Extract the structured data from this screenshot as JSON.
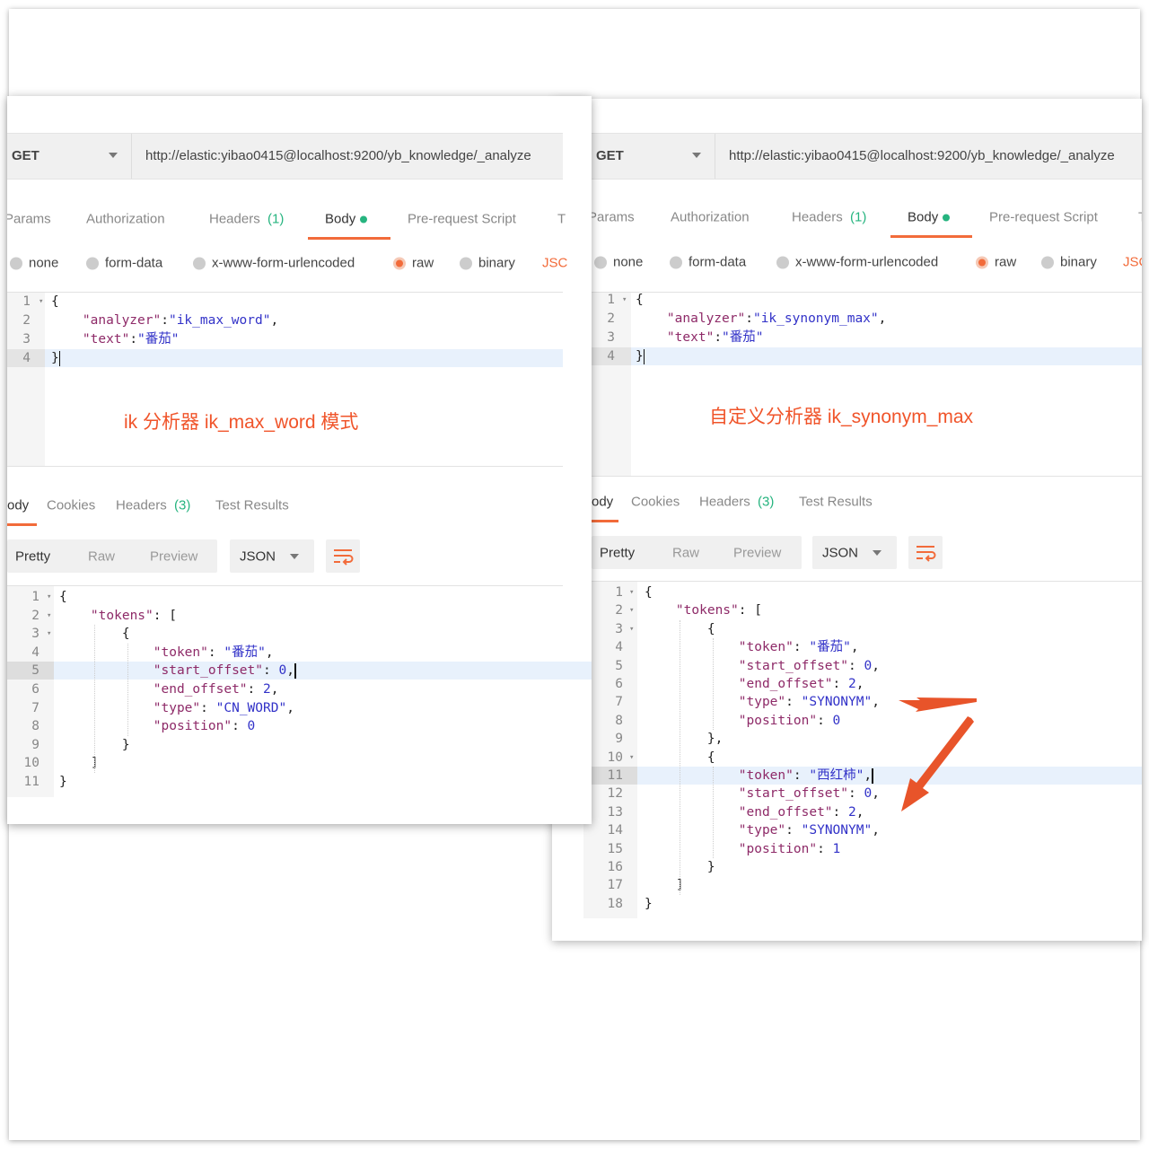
{
  "accent": "#f26b3a",
  "panels": [
    {
      "id": "left",
      "method": "GET",
      "url": "http://elastic:yibao0415@localhost:9200/yb_knowledge/_analyze",
      "tabs": [
        "Params",
        "Authorization",
        "Headers",
        "(1)",
        "Body",
        "Pre-request Script",
        "T"
      ],
      "body_types": [
        "none",
        "form-data",
        "x-www-form-urlencoded",
        "raw",
        "binary",
        "JSC"
      ],
      "annotation": "ik 分析器 ik_max_word 模式",
      "resp_tabs": [
        "ody",
        "Cookies",
        "Headers",
        "(3)",
        "Test Results"
      ],
      "formats": [
        "Pretty",
        "Raw",
        "Preview"
      ],
      "format_select": "JSON",
      "request_lines": [
        [
          [
            "p",
            "{"
          ]
        ],
        [
          [
            "p",
            "    "
          ],
          [
            "k",
            "\"analyzer\""
          ],
          [
            "p",
            ":"
          ],
          [
            "s",
            "\"ik_max_word\""
          ],
          [
            "p",
            ","
          ]
        ],
        [
          [
            "p",
            "    "
          ],
          [
            "k",
            "\"text\""
          ],
          [
            "p",
            ":"
          ],
          [
            "s",
            "\"番茄\""
          ]
        ],
        [
          [
            "p",
            "}"
          ]
        ]
      ],
      "response_lines": [
        [
          [
            "p",
            "{"
          ]
        ],
        [
          [
            "p",
            "    "
          ],
          [
            "k",
            "\"tokens\""
          ],
          [
            "p",
            ": ["
          ]
        ],
        [
          [
            "p",
            "        {"
          ]
        ],
        [
          [
            "p",
            "            "
          ],
          [
            "k",
            "\"token\""
          ],
          [
            "p",
            ": "
          ],
          [
            "s",
            "\"番茄\""
          ],
          [
            "p",
            ","
          ]
        ],
        [
          [
            "p",
            "            "
          ],
          [
            "k",
            "\"start_offset\""
          ],
          [
            "p",
            ": "
          ],
          [
            "n",
            "0"
          ],
          [
            "p",
            ","
          ]
        ],
        [
          [
            "p",
            "            "
          ],
          [
            "k",
            "\"end_offset\""
          ],
          [
            "p",
            ": "
          ],
          [
            "n",
            "2"
          ],
          [
            "p",
            ","
          ]
        ],
        [
          [
            "p",
            "            "
          ],
          [
            "k",
            "\"type\""
          ],
          [
            "p",
            ": "
          ],
          [
            "s",
            "\"CN_WORD\""
          ],
          [
            "p",
            ","
          ]
        ],
        [
          [
            "p",
            "            "
          ],
          [
            "k",
            "\"position\""
          ],
          [
            "p",
            ": "
          ],
          [
            "n",
            "0"
          ]
        ],
        [
          [
            "p",
            "        }"
          ]
        ],
        [
          [
            "p",
            "    ]"
          ]
        ],
        [
          [
            "p",
            "}"
          ]
        ]
      ],
      "response_folds": [
        1,
        2,
        3
      ],
      "response_highlight": 5
    },
    {
      "id": "right",
      "method": "GET",
      "url": "http://elastic:yibao0415@localhost:9200/yb_knowledge/_analyze",
      "tabs": [
        "Params",
        "Authorization",
        "Headers",
        "(1)",
        "Body",
        "Pre-request Script",
        "T"
      ],
      "body_types": [
        "none",
        "form-data",
        "x-www-form-urlencoded",
        "raw",
        "binary",
        "JSC"
      ],
      "annotation": "自定义分析器 ik_synonym_max",
      "resp_tabs": [
        "ody",
        "Cookies",
        "Headers",
        "(3)",
        "Test Results"
      ],
      "formats": [
        "Pretty",
        "Raw",
        "Preview"
      ],
      "format_select": "JSON",
      "request_lines": [
        [
          [
            "p",
            "{"
          ]
        ],
        [
          [
            "p",
            "    "
          ],
          [
            "k",
            "\"analyzer\""
          ],
          [
            "p",
            ":"
          ],
          [
            "s",
            "\"ik_synonym_max\""
          ],
          [
            "p",
            ","
          ]
        ],
        [
          [
            "p",
            "    "
          ],
          [
            "k",
            "\"text\""
          ],
          [
            "p",
            ":"
          ],
          [
            "s",
            "\"番茄\""
          ]
        ],
        [
          [
            "p",
            "}"
          ]
        ]
      ],
      "response_lines": [
        [
          [
            "p",
            "{"
          ]
        ],
        [
          [
            "p",
            "    "
          ],
          [
            "k",
            "\"tokens\""
          ],
          [
            "p",
            ": ["
          ]
        ],
        [
          [
            "p",
            "        {"
          ]
        ],
        [
          [
            "p",
            "            "
          ],
          [
            "k",
            "\"token\""
          ],
          [
            "p",
            ": "
          ],
          [
            "s",
            "\"番茄\""
          ],
          [
            "p",
            ","
          ]
        ],
        [
          [
            "p",
            "            "
          ],
          [
            "k",
            "\"start_offset\""
          ],
          [
            "p",
            ": "
          ],
          [
            "n",
            "0"
          ],
          [
            "p",
            ","
          ]
        ],
        [
          [
            "p",
            "            "
          ],
          [
            "k",
            "\"end_offset\""
          ],
          [
            "p",
            ": "
          ],
          [
            "n",
            "2"
          ],
          [
            "p",
            ","
          ]
        ],
        [
          [
            "p",
            "            "
          ],
          [
            "k",
            "\"type\""
          ],
          [
            "p",
            ": "
          ],
          [
            "s",
            "\"SYNONYM\""
          ],
          [
            "p",
            ","
          ]
        ],
        [
          [
            "p",
            "            "
          ],
          [
            "k",
            "\"position\""
          ],
          [
            "p",
            ": "
          ],
          [
            "n",
            "0"
          ]
        ],
        [
          [
            "p",
            "        },"
          ]
        ],
        [
          [
            "p",
            "        {"
          ]
        ],
        [
          [
            "p",
            "            "
          ],
          [
            "k",
            "\"token\""
          ],
          [
            "p",
            ": "
          ],
          [
            "s",
            "\"西红柿\""
          ],
          [
            "p",
            ","
          ]
        ],
        [
          [
            "p",
            "            "
          ],
          [
            "k",
            "\"start_offset\""
          ],
          [
            "p",
            ": "
          ],
          [
            "n",
            "0"
          ],
          [
            "p",
            ","
          ]
        ],
        [
          [
            "p",
            "            "
          ],
          [
            "k",
            "\"end_offset\""
          ],
          [
            "p",
            ": "
          ],
          [
            "n",
            "2"
          ],
          [
            "p",
            ","
          ]
        ],
        [
          [
            "p",
            "            "
          ],
          [
            "k",
            "\"type\""
          ],
          [
            "p",
            ": "
          ],
          [
            "s",
            "\"SYNONYM\""
          ],
          [
            "p",
            ","
          ]
        ],
        [
          [
            "p",
            "            "
          ],
          [
            "k",
            "\"position\""
          ],
          [
            "p",
            ": "
          ],
          [
            "n",
            "1"
          ]
        ],
        [
          [
            "p",
            "        }"
          ]
        ],
        [
          [
            "p",
            "    ]"
          ]
        ],
        [
          [
            "p",
            "}"
          ]
        ]
      ],
      "response_folds": [
        1,
        2,
        3,
        10
      ],
      "response_highlight": 11
    }
  ]
}
